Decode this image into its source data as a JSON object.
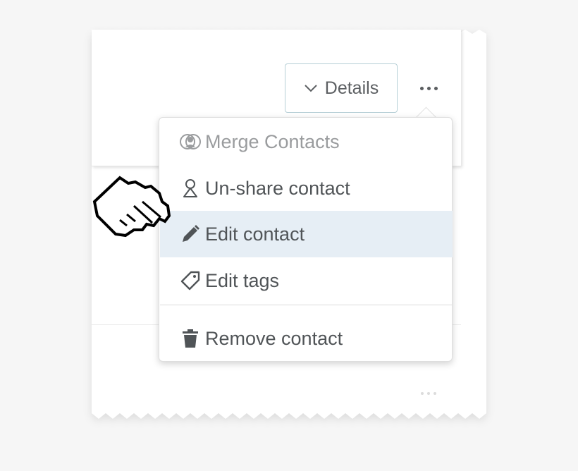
{
  "header": {
    "details_label": "Details",
    "details_icon": "chevron-down-icon",
    "more_icon": "more-options-icon"
  },
  "menu": {
    "items": [
      {
        "label": "Merge Contacts",
        "icon": "merge-contacts-icon",
        "state": "disabled"
      },
      {
        "label": "Un-share contact",
        "icon": "person-icon",
        "state": "normal"
      },
      {
        "label": "Edit contact",
        "icon": "pencil-icon",
        "state": "highlighted"
      },
      {
        "label": "Edit tags",
        "icon": "tag-icon",
        "state": "normal"
      },
      {
        "label": "Remove contact",
        "icon": "trash-icon",
        "state": "normal"
      }
    ]
  },
  "colors": {
    "background": "#f6f6f6",
    "card": "#ffffff",
    "highlight": "#e6eef5",
    "details_border": "#b6cfd6",
    "text": "#505457",
    "disabled_text": "#9a9c9e"
  },
  "cursor": {
    "icon": "pointing-hand-cursor-icon"
  }
}
